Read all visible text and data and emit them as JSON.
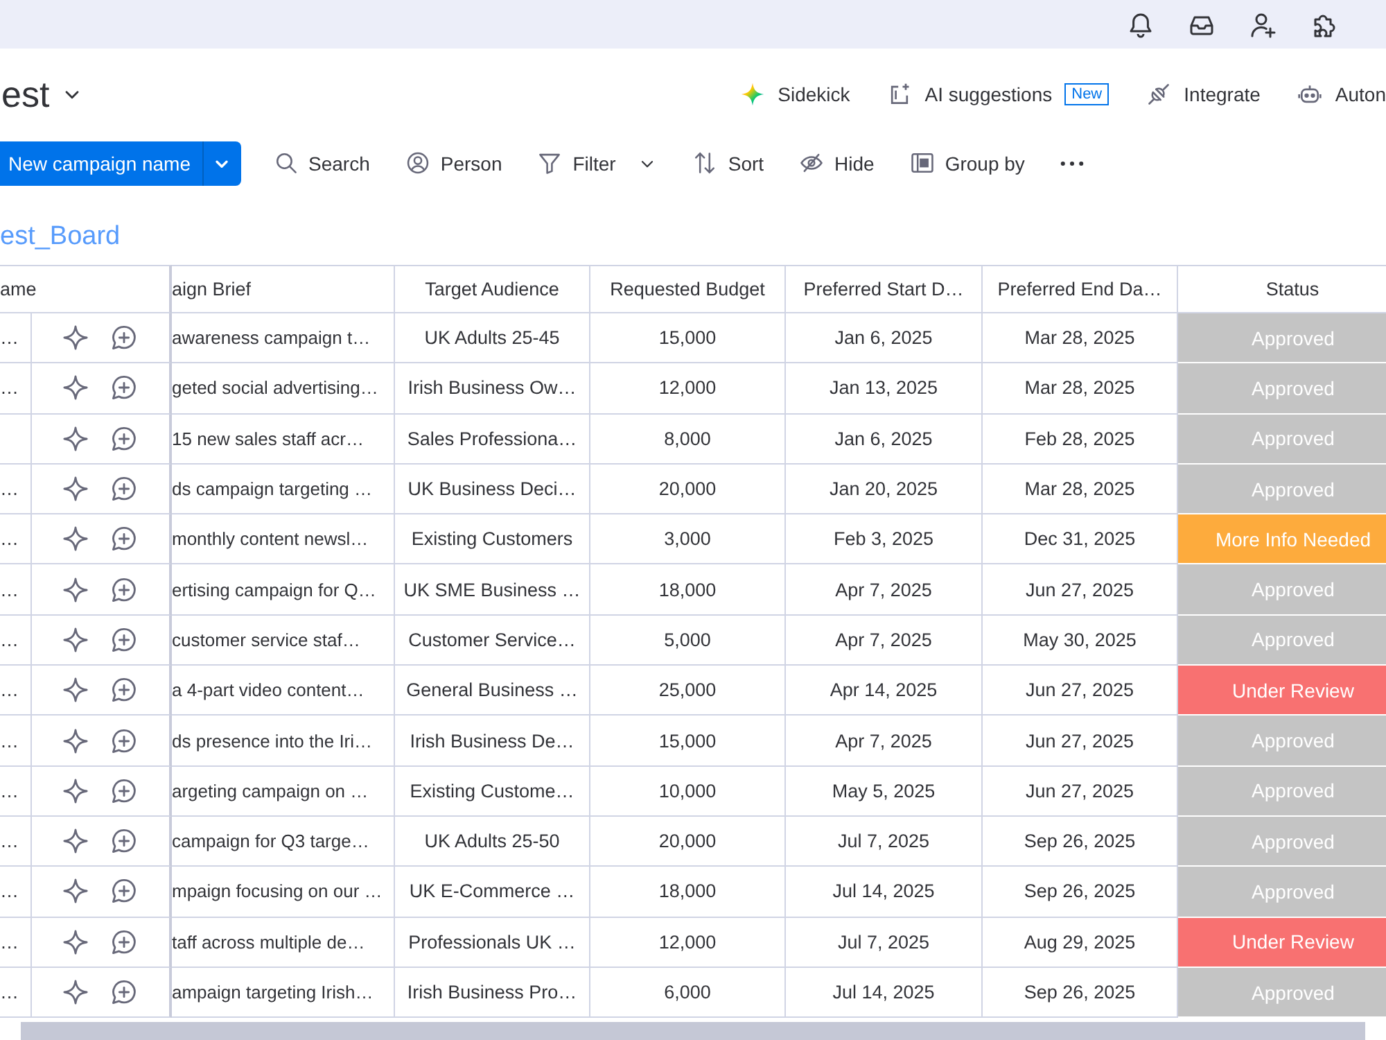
{
  "board": {
    "title": "est"
  },
  "header_actions": [
    {
      "label": "Sidekick"
    },
    {
      "label": "AI suggestions",
      "badge": "New"
    },
    {
      "label": "Integrate"
    },
    {
      "label": "Auton"
    }
  ],
  "toolbar": {
    "primary_button": {
      "label": "New campaign name"
    },
    "tools": [
      {
        "label": "Search",
        "dropdown": false
      },
      {
        "label": "Person",
        "dropdown": false
      },
      {
        "label": "Filter",
        "dropdown": true
      },
      {
        "label": "Sort",
        "dropdown": false
      },
      {
        "label": "Hide",
        "dropdown": false
      },
      {
        "label": "Group by",
        "dropdown": false
      }
    ]
  },
  "group": {
    "title": "est_Board",
    "columns": [
      "ame",
      "aign Brief",
      "Target Audience",
      "Requested Budget",
      "Preferred Start D…",
      "Preferred End Da…",
      "Status"
    ],
    "rows": [
      {
        "name": "…",
        "brief": "awareness campaign t…",
        "audience": "UK Adults 25-45",
        "budget": "15,000",
        "start": "Jan 6, 2025",
        "end": "Mar 28, 2025",
        "status": {
          "label": "Approved",
          "color": "#c4c4c4"
        }
      },
      {
        "name": "…",
        "brief": "geted social advertising…",
        "audience": "Irish Business Ow…",
        "budget": "12,000",
        "start": "Jan 13, 2025",
        "end": "Mar 28, 2025",
        "status": {
          "label": "Approved",
          "color": "#c4c4c4"
        }
      },
      {
        "brief": "15 new sales staff acr…",
        "audience": "Sales Professiona…",
        "budget": "8,000",
        "start": "Jan 6, 2025",
        "end": "Feb 28, 2025",
        "status": {
          "label": "Approved",
          "color": "#c4c4c4"
        }
      },
      {
        "name": "…",
        "brief": "ds campaign targeting …",
        "audience": "UK Business Deci…",
        "budget": "20,000",
        "start": "Jan 20, 2025",
        "end": "Mar 28, 2025",
        "status": {
          "label": "Approved",
          "color": "#c4c4c4"
        }
      },
      {
        "name": "…",
        "brief": "monthly content newsl…",
        "audience": "Existing Customers",
        "budget": "3,000",
        "start": "Feb 3, 2025",
        "end": "Dec 31, 2025",
        "status": {
          "label": "More Info Needed",
          "color": "#fdab3d"
        }
      },
      {
        "name": "…",
        "brief": "ertising campaign for Q…",
        "audience": "UK SME Business …",
        "budget": "18,000",
        "start": "Apr 7, 2025",
        "end": "Jun 27, 2025",
        "status": {
          "label": "Approved",
          "color": "#c4c4c4"
        }
      },
      {
        "name": "…",
        "brief": "customer service staf…",
        "audience": "Customer Service…",
        "budget": "5,000",
        "start": "Apr 7, 2025",
        "end": "May 30, 2025",
        "status": {
          "label": "Approved",
          "color": "#c4c4c4"
        }
      },
      {
        "name": "…",
        "brief": "a 4-part video content…",
        "audience": "General Business …",
        "budget": "25,000",
        "start": "Apr 14, 2025",
        "end": "Jun 27, 2025",
        "status": {
          "label": "Under Review",
          "color": "#f87171"
        }
      },
      {
        "name": "…",
        "brief": "ds presence into the Iri…",
        "audience": "Irish Business De…",
        "budget": "15,000",
        "start": "Apr 7, 2025",
        "end": "Jun 27, 2025",
        "status": {
          "label": "Approved",
          "color": "#c4c4c4"
        }
      },
      {
        "name": "…",
        "brief": "argeting campaign on …",
        "audience": "Existing Custome…",
        "budget": "10,000",
        "start": "May 5, 2025",
        "end": "Jun 27, 2025",
        "status": {
          "label": "Approved",
          "color": "#c4c4c4"
        }
      },
      {
        "name": "…",
        "brief": "campaign for Q3 targe…",
        "audience": "UK Adults 25-50",
        "budget": "20,000",
        "start": "Jul 7, 2025",
        "end": "Sep 26, 2025",
        "status": {
          "label": "Approved",
          "color": "#c4c4c4"
        }
      },
      {
        "name": "…",
        "brief": "mpaign focusing on our …",
        "audience": "UK E-Commerce …",
        "budget": "18,000",
        "start": "Jul 14, 2025",
        "end": "Sep 26, 2025",
        "status": {
          "label": "Approved",
          "color": "#c4c4c4"
        }
      },
      {
        "name": "…",
        "brief": "taff across multiple de…",
        "audience": "Professionals UK …",
        "budget": "12,000",
        "start": "Jul 7, 2025",
        "end": "Aug 29, 2025",
        "status": {
          "label": "Under Review",
          "color": "#f87171"
        }
      },
      {
        "name": "…",
        "brief": "ampaign targeting Irish…",
        "audience": "Irish Business Pro…",
        "budget": "6,000",
        "start": "Jul 14, 2025",
        "end": "Sep 26, 2025",
        "status": {
          "label": "Approved",
          "color": "#c4c4c4"
        }
      }
    ]
  }
}
